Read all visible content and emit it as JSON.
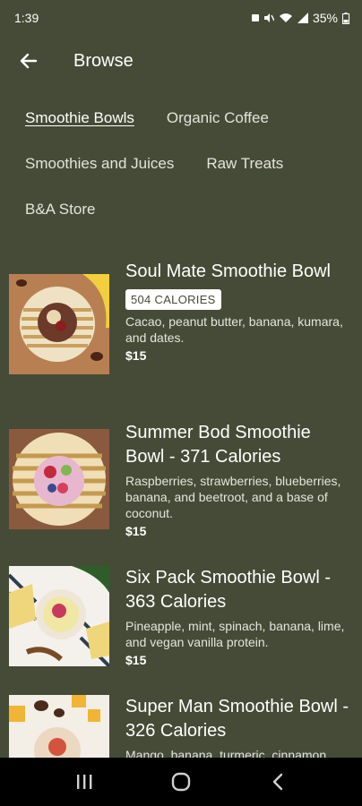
{
  "status_bar": {
    "time": "1:39",
    "battery": "35%"
  },
  "app_bar": {
    "title": "Browse"
  },
  "categories": [
    {
      "label": "Smoothie Bowls",
      "active": true
    },
    {
      "label": "Organic Coffee",
      "active": false
    },
    {
      "label": "Smoothies and Juices",
      "active": false
    },
    {
      "label": "Raw Treats",
      "active": false
    },
    {
      "label": "B&A Store",
      "active": false
    }
  ],
  "products": [
    {
      "name": "Soul Mate Smoothie Bowl",
      "badge": "504 CALORIES",
      "description": "Cacao, peanut butter, banana, kumara, and dates.",
      "price": "$15"
    },
    {
      "name": "Summer Bod Smoothie Bowl - 371 Calories",
      "description": "Raspberries, strawberries, blueberries, banana, and beetroot, and a base of coconut.",
      "price": "$15"
    },
    {
      "name": "Six Pack Smoothie Bowl - 363 Calories",
      "description": "Pineapple, mint, spinach, banana, lime, and vegan vanilla protein.",
      "price": "$15"
    },
    {
      "name": "Super Man Smoothie Bowl - 326 Calories",
      "description": "Mango, banana, turmeric, cinnamon",
      "price": ""
    }
  ],
  "colors": {
    "background": "#464b37",
    "badge_text": "#464b37"
  }
}
